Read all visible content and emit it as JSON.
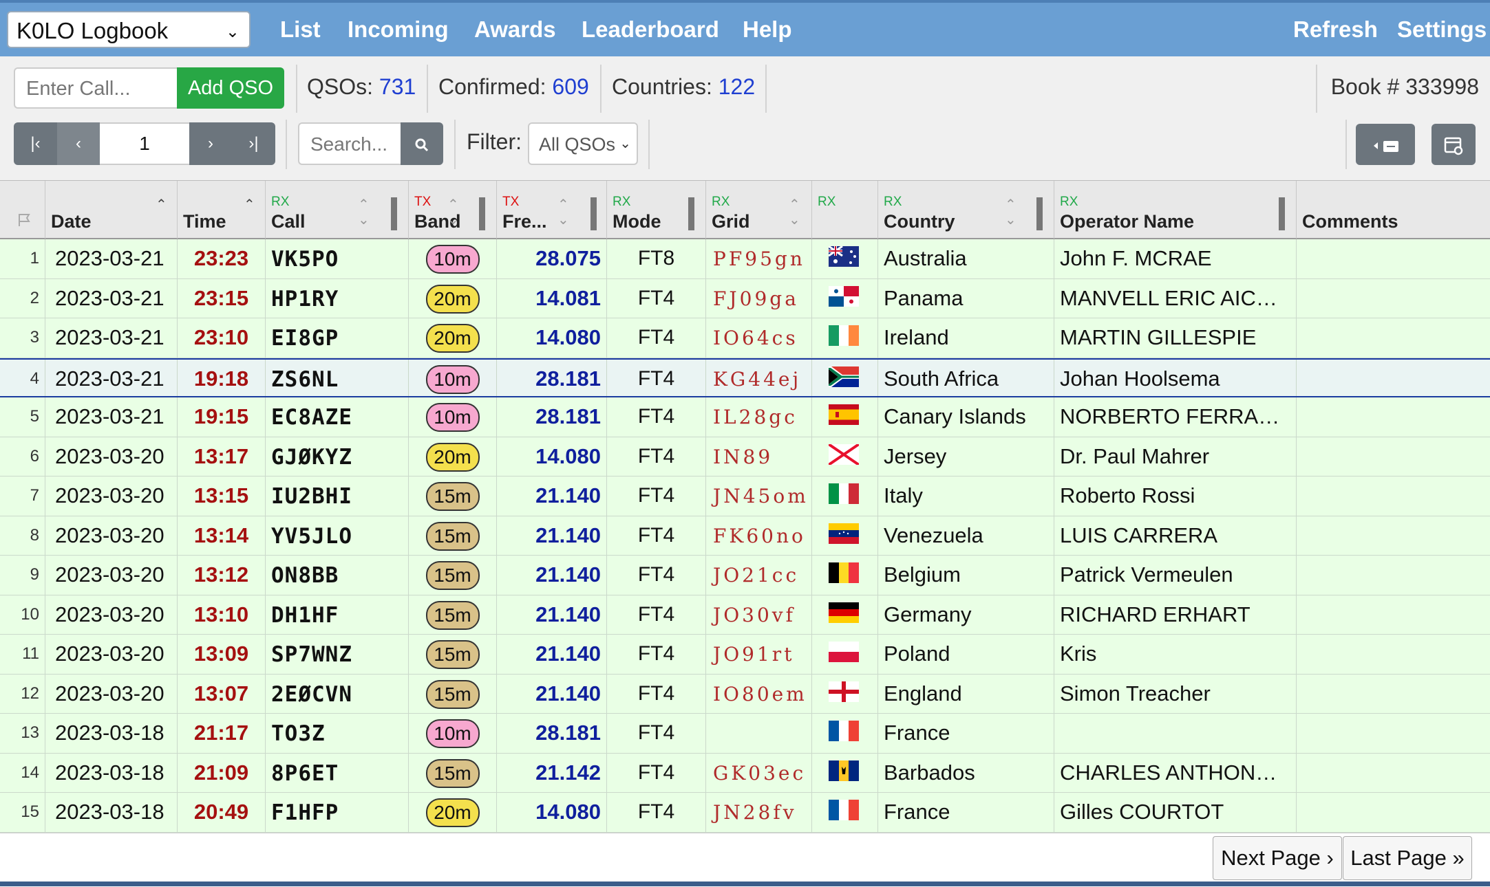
{
  "nav": {
    "logbook_select": "K0LO Logbook",
    "items": [
      "List",
      "Incoming",
      "Awards",
      "Leaderboard",
      "Help"
    ],
    "right_items": [
      "Refresh",
      "Settings"
    ]
  },
  "toolbar": {
    "call_placeholder": "Enter Call...",
    "add_button": "Add QSO",
    "qsos_label": "QSOs:",
    "qsos_value": "731",
    "confirmed_label": "Confirmed:",
    "confirmed_value": "609",
    "countries_label": "Countries:",
    "countries_value": "122",
    "book": "Book # 333998",
    "page_value": "1",
    "search_placeholder": "Search...",
    "filter_label": "Filter:",
    "filter_value": "All QSOs"
  },
  "table": {
    "headers": {
      "date": "Date",
      "time": "Time",
      "call": "Call",
      "band": "Band",
      "freq": "Fre...",
      "mode": "Mode",
      "grid": "Grid",
      "country": "Country",
      "operator": "Operator Name",
      "comments": "Comments",
      "rx": "RX",
      "tx": "TX"
    },
    "rows": [
      {
        "idx": "1",
        "date": "2023-03-21",
        "time": "23:23",
        "call": "VK5PO",
        "band": "10m",
        "freq": "28.075",
        "mode": "FT8",
        "grid": "PF95gn",
        "country": "Australia",
        "operator": "John F. MCRAE",
        "comments": ""
      },
      {
        "idx": "2",
        "date": "2023-03-21",
        "time": "23:15",
        "call": "HP1RY",
        "band": "20m",
        "freq": "14.081",
        "mode": "FT4",
        "grid": "FJ09ga",
        "country": "Panama",
        "operator": "MANVELL ERIC AIC…",
        "comments": ""
      },
      {
        "idx": "3",
        "date": "2023-03-21",
        "time": "23:10",
        "call": "EI8GP",
        "band": "20m",
        "freq": "14.080",
        "mode": "FT4",
        "grid": "IO64cs",
        "country": "Ireland",
        "operator": "MARTIN GILLESPIE",
        "comments": ""
      },
      {
        "idx": "4",
        "date": "2023-03-21",
        "time": "19:18",
        "call": "ZS6NL",
        "band": "10m",
        "freq": "28.181",
        "mode": "FT4",
        "grid": "KG44ej",
        "country": "South Africa",
        "operator": "Johan Hoolsema",
        "comments": ""
      },
      {
        "idx": "5",
        "date": "2023-03-21",
        "time": "19:15",
        "call": "EC8AZE",
        "band": "10m",
        "freq": "28.181",
        "mode": "FT4",
        "grid": "IL28gc",
        "country": "Canary Islands",
        "operator": "NORBERTO FERRA…",
        "comments": ""
      },
      {
        "idx": "6",
        "date": "2023-03-20",
        "time": "13:17",
        "call": "GJØKYZ",
        "band": "20m",
        "freq": "14.080",
        "mode": "FT4",
        "grid": "IN89",
        "country": "Jersey",
        "operator": "Dr. Paul Mahrer",
        "comments": ""
      },
      {
        "idx": "7",
        "date": "2023-03-20",
        "time": "13:15",
        "call": "IU2BHI",
        "band": "15m",
        "freq": "21.140",
        "mode": "FT4",
        "grid": "JN45om",
        "country": "Italy",
        "operator": "Roberto Rossi",
        "comments": ""
      },
      {
        "idx": "8",
        "date": "2023-03-20",
        "time": "13:14",
        "call": "YV5JLO",
        "band": "15m",
        "freq": "21.140",
        "mode": "FT4",
        "grid": "FK60no",
        "country": "Venezuela",
        "operator": "LUIS CARRERA",
        "comments": ""
      },
      {
        "idx": "9",
        "date": "2023-03-20",
        "time": "13:12",
        "call": "ON8BB",
        "band": "15m",
        "freq": "21.140",
        "mode": "FT4",
        "grid": "JO21cc",
        "country": "Belgium",
        "operator": "Patrick Vermeulen",
        "comments": ""
      },
      {
        "idx": "10",
        "date": "2023-03-20",
        "time": "13:10",
        "call": "DH1HF",
        "band": "15m",
        "freq": "21.140",
        "mode": "FT4",
        "grid": "JO30vf",
        "country": "Germany",
        "operator": "RICHARD ERHART",
        "comments": ""
      },
      {
        "idx": "11",
        "date": "2023-03-20",
        "time": "13:09",
        "call": "SP7WNZ",
        "band": "15m",
        "freq": "21.140",
        "mode": "FT4",
        "grid": "JO91rt",
        "country": "Poland",
        "operator": "Kris",
        "comments": ""
      },
      {
        "idx": "12",
        "date": "2023-03-20",
        "time": "13:07",
        "call": "2EØCVN",
        "band": "15m",
        "freq": "21.140",
        "mode": "FT4",
        "grid": "IO80em",
        "country": "England",
        "operator": "Simon Treacher",
        "comments": ""
      },
      {
        "idx": "13",
        "date": "2023-03-18",
        "time": "21:17",
        "call": "TO3Z",
        "band": "10m",
        "freq": "28.181",
        "mode": "FT4",
        "grid": "",
        "country": "France",
        "operator": "",
        "comments": ""
      },
      {
        "idx": "14",
        "date": "2023-03-18",
        "time": "21:09",
        "call": "8P6ET",
        "band": "15m",
        "freq": "21.142",
        "mode": "FT4",
        "grid": "GK03ec",
        "country": "Barbados",
        "operator": "CHARLES ANTHON…",
        "comments": ""
      },
      {
        "idx": "15",
        "date": "2023-03-18",
        "time": "20:49",
        "call": "F1HFP",
        "band": "20m",
        "freq": "14.080",
        "mode": "FT4",
        "grid": "JN28fv",
        "country": "France",
        "operator": "Gilles COURTOT",
        "comments": ""
      }
    ]
  },
  "footer": {
    "next_page": "Next Page ›",
    "last_page": "Last Page »"
  },
  "colors": {
    "nav_bg": "#6a9fd3",
    "add_button": "#28a745",
    "row_bg": "#e9ffe5",
    "band_10m": "#f7a8cf",
    "band_15m": "#d9c289",
    "band_20m": "#f4e04d",
    "time_text": "#a51010",
    "freq_text": "#0f1f9d",
    "grid_text": "#b02a2a",
    "stat_number": "#1f3fd1"
  }
}
